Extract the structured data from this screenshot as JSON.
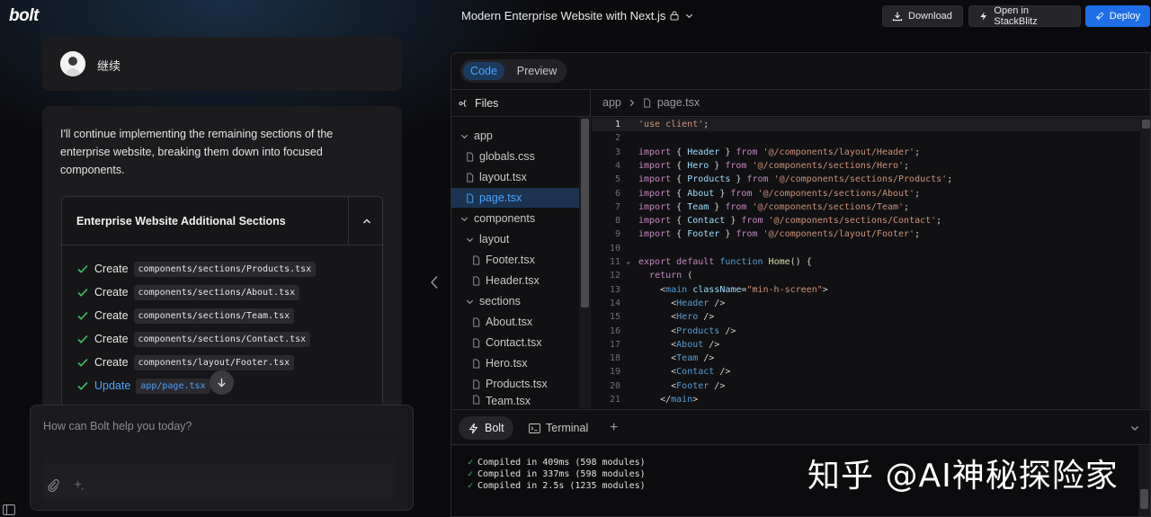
{
  "app": {
    "logo": "bolt",
    "project_title": "Modern Enterprise Website with Next.js"
  },
  "header": {
    "download_label": "Download",
    "stackblitz_label": "Open in StackBlitz",
    "deploy_label": "Deploy"
  },
  "chat": {
    "user_message": "继续",
    "assistant_text": "I'll continue implementing the remaining sections of the enterprise website, breaking them down into focused components.",
    "artifact_title": "Enterprise Website Additional Sections",
    "actions": [
      {
        "verb": "Create",
        "path": "components/sections/Products.tsx"
      },
      {
        "verb": "Create",
        "path": "components/sections/About.tsx"
      },
      {
        "verb": "Create",
        "path": "components/sections/Team.tsx"
      },
      {
        "verb": "Create",
        "path": "components/sections/Contact.tsx"
      },
      {
        "verb": "Create",
        "path": "components/layout/Footer.tsx"
      },
      {
        "verb": "Update",
        "path": "app/page.tsx"
      }
    ],
    "prompt_placeholder": "How can Bolt help you today?"
  },
  "workbench": {
    "tabs": {
      "code": "Code",
      "preview": "Preview"
    },
    "files_title": "Files",
    "tree": [
      {
        "label": "app",
        "type": "folder",
        "depth": 0
      },
      {
        "label": "globals.css",
        "type": "file",
        "depth": 1
      },
      {
        "label": "layout.tsx",
        "type": "file",
        "depth": 1
      },
      {
        "label": "page.tsx",
        "type": "file",
        "depth": 1,
        "active": true
      },
      {
        "label": "components",
        "type": "folder",
        "depth": 0
      },
      {
        "label": "layout",
        "type": "folder",
        "depth": 1
      },
      {
        "label": "Footer.tsx",
        "type": "file",
        "depth": 2
      },
      {
        "label": "Header.tsx",
        "type": "file",
        "depth": 2
      },
      {
        "label": "sections",
        "type": "folder",
        "depth": 1
      },
      {
        "label": "About.tsx",
        "type": "file",
        "depth": 2
      },
      {
        "label": "Contact.tsx",
        "type": "file",
        "depth": 2
      },
      {
        "label": "Hero.tsx",
        "type": "file",
        "depth": 2
      },
      {
        "label": "Products.tsx",
        "type": "file",
        "depth": 2
      },
      {
        "label": "Team.tsx",
        "type": "file",
        "depth": 2
      }
    ],
    "breadcrumb": {
      "folder": "app",
      "file": "page.tsx"
    },
    "code_lines": [
      "'use client';",
      "",
      "import { Header } from '@/components/layout/Header';",
      "import { Hero } from '@/components/sections/Hero';",
      "import { Products } from '@/components/sections/Products';",
      "import { About } from '@/components/sections/About';",
      "import { Team } from '@/components/sections/Team';",
      "import { Contact } from '@/components/sections/Contact';",
      "import { Footer } from '@/components/layout/Footer';",
      "",
      "export default function Home() {",
      "  return (",
      "    <main className=\"min-h-screen\">",
      "      <Header />",
      "      <Hero />",
      "      <Products />",
      "      <About />",
      "      <Team />",
      "      <Contact />",
      "      <Footer />",
      "    </main>"
    ],
    "terminal_tabs": {
      "bolt": "Bolt",
      "terminal": "Terminal",
      "add": "+"
    },
    "terminal_output": [
      "Compiled in 409ms (598 modules)",
      "Compiled in 337ms (598 modules)",
      "Compiled in 2.5s (1235 modules)"
    ]
  },
  "watermark": "知乎 @AI神秘探险家",
  "colors": {
    "accent": "#1e6fe6",
    "link": "#4aa3ff",
    "success": "#3fbf5f"
  }
}
